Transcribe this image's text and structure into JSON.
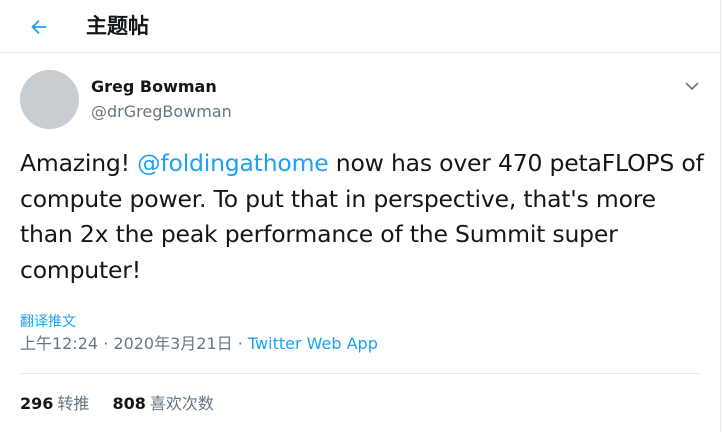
{
  "header": {
    "title": "主题帖",
    "back_icon": "arrow-left-icon"
  },
  "author": {
    "name": "Greg Bowman",
    "handle": "@drGregBowman"
  },
  "tweet": {
    "text_before": "Amazing! ",
    "mention": "@foldingathome",
    "text_after": " now has over 470 petaFLOPS of compute power. To put that in perspective, that's more than 2x the peak performance of the Summit super computer!"
  },
  "translate_label": "翻译推文",
  "meta": {
    "time": "上午12:24",
    "sep1": " · ",
    "date": "2020年3月21日",
    "sep2": " · ",
    "source": "Twitter Web App"
  },
  "stats": {
    "retweets_count": "296",
    "retweets_label": "转推",
    "likes_count": "808",
    "likes_label": "喜欢次数"
  },
  "colors": {
    "accent": "#1da1f2",
    "muted": "#657786",
    "text": "#14171a",
    "border": "#e6ecf0"
  }
}
